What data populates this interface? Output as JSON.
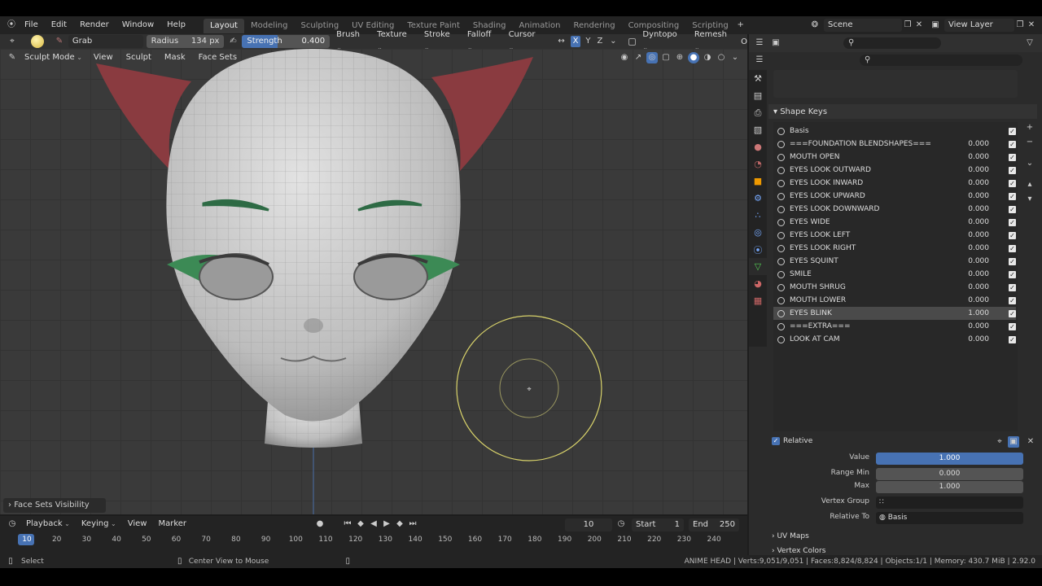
{
  "top_menu": {
    "items": [
      "File",
      "Edit",
      "Render",
      "Window",
      "Help"
    ],
    "workspace_tabs": [
      "Layout",
      "Modeling",
      "Sculpting",
      "UV Editing",
      "Texture Paint",
      "Shading",
      "Animation",
      "Rendering",
      "Compositing",
      "Scripting"
    ],
    "active_tab": "Layout",
    "scene": "Scene",
    "view_layer": "View Layer"
  },
  "tool_header": {
    "brush_name": "Grab",
    "radius_label": "Radius",
    "radius_value": "134 px",
    "strength_label": "Strength",
    "strength_value": "0.400",
    "strength_fraction": 0.4,
    "menus": [
      "Brush",
      "Texture",
      "Stroke",
      "Falloff",
      "Cursor"
    ],
    "axes": [
      "X",
      "Y",
      "Z"
    ],
    "dyntopo": "Dyntopo",
    "remesh": "Remesh",
    "overflow": "O"
  },
  "viewport_header": {
    "mode": "Sculpt Mode",
    "menus": [
      "View",
      "Sculpt",
      "Mask",
      "Face Sets"
    ]
  },
  "viewport": {
    "popup": "Face Sets Visibility"
  },
  "properties": {
    "section_title": "Shape Keys",
    "shape_keys": [
      {
        "name": "Basis",
        "value": ""
      },
      {
        "name": "===FOUNDATION BLENDSHAPES===",
        "value": "0.000"
      },
      {
        "name": "MOUTH OPEN",
        "value": "0.000"
      },
      {
        "name": "EYES LOOK OUTWARD",
        "value": "0.000"
      },
      {
        "name": "EYES LOOK INWARD",
        "value": "0.000"
      },
      {
        "name": "EYES LOOK UPWARD",
        "value": "0.000"
      },
      {
        "name": "EYES LOOK DOWNWARD",
        "value": "0.000"
      },
      {
        "name": "EYES WIDE",
        "value": "0.000"
      },
      {
        "name": "EYES LOOK LEFT",
        "value": "0.000"
      },
      {
        "name": "EYES LOOK RIGHT",
        "value": "0.000"
      },
      {
        "name": "EYES SQUINT",
        "value": "0.000"
      },
      {
        "name": "SMILE",
        "value": "0.000"
      },
      {
        "name": "MOUTH SHRUG",
        "value": "0.000"
      },
      {
        "name": "MOUTH LOWER",
        "value": "0.000"
      },
      {
        "name": "EYES BLINK",
        "value": "1.000",
        "active": true
      },
      {
        "name": "===EXTRA===",
        "value": "0.000"
      },
      {
        "name": "LOOK AT CAM",
        "value": "0.000"
      }
    ],
    "relative_label": "Relative",
    "value_label": "Value",
    "value": "1.000",
    "range_min_label": "Range Min",
    "range_min": "0.000",
    "max_label": "Max",
    "max": "1.000",
    "vertex_group_label": "Vertex Group",
    "relative_to_label": "Relative To",
    "relative_to": "Basis",
    "uv_maps": "UV Maps",
    "vertex_colors": "Vertex Colors"
  },
  "timeline": {
    "menus": [
      "Playback",
      "Keying",
      "View",
      "Marker"
    ],
    "current_frame": "10",
    "start_label": "Start",
    "start": "1",
    "end_label": "End",
    "end": "250",
    "ticks": [
      "10",
      "20",
      "30",
      "40",
      "50",
      "60",
      "70",
      "80",
      "90",
      "100",
      "110",
      "120",
      "130",
      "140",
      "150",
      "160",
      "170",
      "180",
      "190",
      "200",
      "210",
      "220",
      "230",
      "240"
    ]
  },
  "status_bar": {
    "left_hint": "Select",
    "mid_hint": "Center View to Mouse",
    "stats": "ANIME HEAD | Verts:9,051/9,051 | Faces:8,824/8,824 | Objects:1/1 | Memory: 430.7 MiB | 2.92.0"
  },
  "colors": {
    "accent_blue": "#4772b3",
    "active_tab": "#3b3b3b",
    "brush_circle": "#d8d26a",
    "hair": "#8a3b40",
    "eyebrow": "#2e6b45"
  }
}
